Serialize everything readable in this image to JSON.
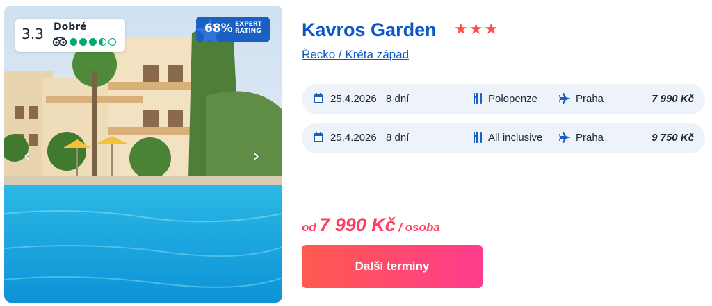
{
  "photo": {
    "rating_score": "3.3",
    "rating_label": "Dobré",
    "rating_dots": 3.5,
    "expert_percent": "68%",
    "expert_line1": "EXPERT",
    "expert_line2": "RATING",
    "prev_arrow": "‹",
    "next_arrow": "›"
  },
  "hotel": {
    "name": "Kavros Garden",
    "stars": "★★★",
    "star_count": 3,
    "location": "Řecko / Kréta západ"
  },
  "offers": [
    {
      "date": "25.4.2026",
      "days": "8 dní",
      "board": "Polopenze",
      "departure": "Praha",
      "price": "7 990 Kč"
    },
    {
      "date": "25.4.2026",
      "days": "8 dní",
      "board": "All inclusive",
      "departure": "Praha",
      "price": "9 750 Kč"
    }
  ],
  "summary": {
    "od": "od",
    "price": "7 990 Kč",
    "per": "/ osoba"
  },
  "cta": {
    "label": "Další termíny"
  },
  "colors": {
    "brand": "#0b57c8",
    "accent": "#ff3d5f",
    "tripadvisor": "#00aa6c",
    "offer_bg": "#eef2f9"
  },
  "icons": [
    "calendar-icon",
    "cutlery-icon",
    "plane-icon",
    "owl-icon",
    "chevron-left-icon",
    "chevron-right-icon"
  ]
}
